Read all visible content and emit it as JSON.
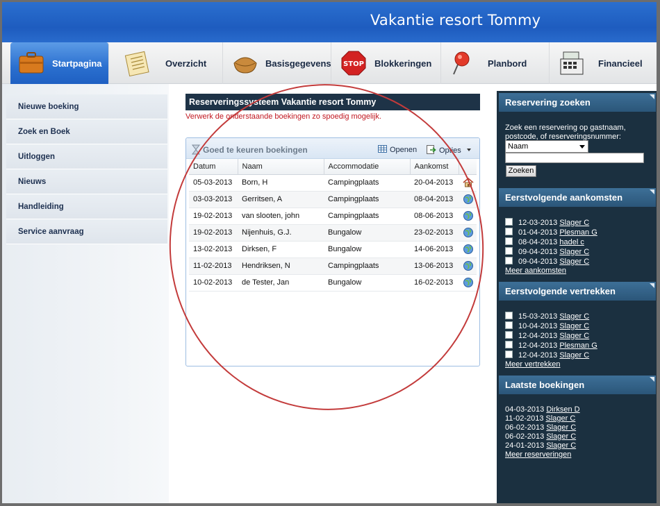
{
  "app_title": "Vakantie resort Tommy",
  "tabs": [
    {
      "label": "Startpagina",
      "icon": "briefcase-icon"
    },
    {
      "label": "Overzicht",
      "icon": "document-icon"
    },
    {
      "label": "Basisgegevens",
      "icon": "purse-icon"
    },
    {
      "label": "Blokkeringen",
      "icon": "stop-sign-icon"
    },
    {
      "label": "Planbord",
      "icon": "pushpin-icon"
    },
    {
      "label": "Financieel",
      "icon": "cash-register-icon"
    }
  ],
  "sidebar": {
    "items": [
      {
        "label": "Nieuwe boeking"
      },
      {
        "label": "Zoek en Boek"
      },
      {
        "label": "Uitloggen"
      },
      {
        "label": "Nieuws"
      },
      {
        "label": "Handleiding"
      },
      {
        "label": "Service aanvraag"
      }
    ]
  },
  "main": {
    "title": "Reserveringssysteem Vakantie resort Tommy",
    "warning": "Verwerk de onderstaande boekingen zo spoedig mogelijk.",
    "panel": {
      "title": "Goed te keuren boekingen",
      "open_label": "Openen",
      "options_label": "Opties",
      "columns": [
        "Datum",
        "Naam",
        "Accommodatie",
        "Aankomst"
      ],
      "rows": [
        {
          "datum": "05-03-2013",
          "naam": "Born, H",
          "accommodatie": "Campingplaats",
          "aankomst": "20-04-2013",
          "icon": "house-icon"
        },
        {
          "datum": "03-03-2013",
          "naam": "Gerritsen, A",
          "accommodatie": "Campingplaats",
          "aankomst": "08-04-2013",
          "icon": "globe-icon"
        },
        {
          "datum": "19-02-2013",
          "naam": "van slooten, john",
          "accommodatie": "Campingplaats",
          "aankomst": "08-06-2013",
          "icon": "globe-icon"
        },
        {
          "datum": "19-02-2013",
          "naam": "Nijenhuis, G.J.",
          "accommodatie": "Bungalow",
          "aankomst": "23-02-2013",
          "icon": "globe-icon"
        },
        {
          "datum": "13-02-2013",
          "naam": "Dirksen, F",
          "accommodatie": "Bungalow",
          "aankomst": "14-06-2013",
          "icon": "globe-icon"
        },
        {
          "datum": "11-02-2013",
          "naam": "Hendriksen, N",
          "accommodatie": "Campingplaats",
          "aankomst": "13-06-2013",
          "icon": "globe-icon"
        },
        {
          "datum": "10-02-2013",
          "naam": "de Tester, Jan",
          "accommodatie": "Bungalow",
          "aankomst": "16-02-2013",
          "icon": "globe-icon"
        }
      ]
    }
  },
  "right": {
    "search": {
      "title": "Reservering zoeken",
      "desc_line1": "Zoek een reservering op gastnaam,",
      "desc_line2": "postcode, of reserveringsnummer:",
      "select_value": "Naam",
      "button": "Zoeken"
    },
    "arrivals": {
      "title": "Eerstvolgende aankomsten",
      "items": [
        {
          "date": "12-03-2013",
          "name": "Slager C"
        },
        {
          "date": "01-04-2013",
          "name": "Plesman G"
        },
        {
          "date": "08-04-2013",
          "name": "hadel c"
        },
        {
          "date": "09-04-2013",
          "name": "Slager C"
        },
        {
          "date": "09-04-2013",
          "name": "Slager C"
        }
      ],
      "more": "Meer aankomsten"
    },
    "departures": {
      "title": "Eerstvolgende vertrekken",
      "items": [
        {
          "date": "15-03-2013",
          "name": "Slager C"
        },
        {
          "date": "10-04-2013",
          "name": "Slager C"
        },
        {
          "date": "12-04-2013",
          "name": "Slager C"
        },
        {
          "date": "12-04-2013",
          "name": "Plesman G"
        },
        {
          "date": "12-04-2013",
          "name": "Slager C"
        }
      ],
      "more": "Meer vertrekken"
    },
    "latest": {
      "title": "Laatste boekingen",
      "items": [
        {
          "date": "04-03-2013",
          "name": "Dirksen D"
        },
        {
          "date": "11-02-2013",
          "name": "Slager C"
        },
        {
          "date": "06-02-2013",
          "name": "Slager C"
        },
        {
          "date": "06-02-2013",
          "name": "Slager C"
        },
        {
          "date": "24-01-2013",
          "name": "Slager C"
        }
      ],
      "more": "Meer reserveringen"
    }
  },
  "colors": {
    "header_blue": "#1e5cbf",
    "dark_panel": "#1b3040",
    "annotation_red": "#c33b3b",
    "warning_red": "#c0161f"
  }
}
